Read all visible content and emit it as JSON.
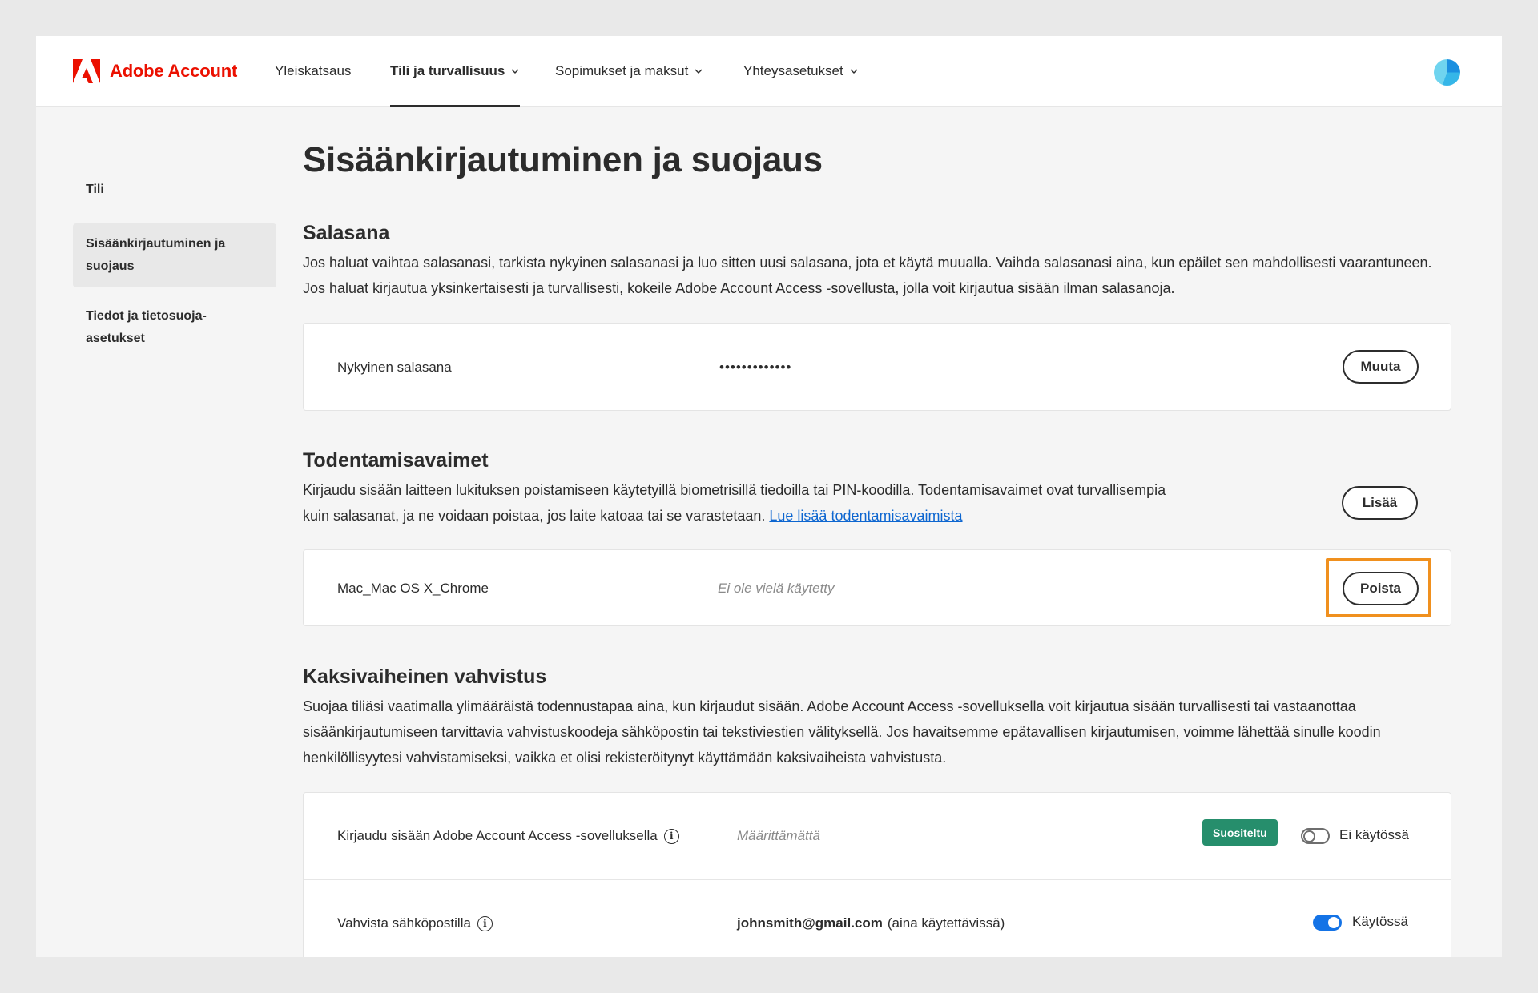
{
  "app": {
    "brand": "Adobe Account",
    "brand_color": "#eb1000"
  },
  "nav": {
    "items": [
      {
        "label": "Yleiskatsaus"
      },
      {
        "label": "Tili ja turvallisuus",
        "active": true
      },
      {
        "label": "Sopimukset ja maksut"
      },
      {
        "label": "Yhteysasetukset"
      }
    ]
  },
  "sidebar": {
    "items": [
      {
        "label": "Tili"
      },
      {
        "label": "Sisäänkirjautuminen ja suojaus",
        "selected": true
      },
      {
        "label": "Tiedot ja tietosuoja-asetukset"
      }
    ]
  },
  "main": {
    "title": "Sisäänkirjautuminen ja suojaus",
    "password": {
      "title": "Salasana",
      "description": "Jos haluat vaihtaa salasanasi, tarkista nykyinen salasanasi ja luo sitten uusi salasana, jota et käytä muualla. Vaihda salasanasi aina, kun epäilet sen mahdollisesti vaarantuneen. Jos haluat kirjautua yksinkertaisesti ja turvallisesti, kokeile Adobe Account Access -sovellusta, jolla voit kirjautua sisään ilman salasanoja.",
      "label": "Nykyinen salasana",
      "value": "•••••••••••••",
      "button": "Muuta"
    },
    "passkeys": {
      "title": "Todentamisavaimet",
      "description": "Kirjaudu sisään laitteen lukituksen poistamiseen käytetyillä biometrisillä tiedoilla tai PIN-koodilla. Todentamisavaimet ovat turvallisempia kuin salasanat, ja ne voidaan poistaa, jos laite katoaa tai se varastetaan.",
      "link": "Lue lisää todentamisavaimista",
      "add_button": "Lisää",
      "device": "Mac_Mac OS X_Chrome",
      "status": "Ei ole vielä käytetty",
      "remove_button": "Poista",
      "highlight_color": "#f0901e"
    },
    "two_step": {
      "title": "Kaksivaiheinen vahvistus",
      "description": "Suojaa tiliäsi vaatimalla ylimääräistä todennustapaa aina, kun kirjaudut sisään. Adobe Account Access -sovelluksella voit kirjautua sisään turvallisesti tai vastaanottaa sisäänkirjautumiseen tarvittavia vahvistuskoodeja sähköpostin tai tekstiviestien välityksellä. Jos havaitsemme epätavallisen kirjautumisen, voimme lähettää sinulle koodin henkilöllisyytesi vahvistamiseksi, vaikka et olisi rekisteröitynyt käyttämään kaksivaiheista vahvistusta.",
      "app_row": {
        "label": "Kirjaudu sisään Adobe Account Access -sovelluksella",
        "value": "Määrittämättä",
        "badge": "Suositeltu",
        "toggle_state": "off",
        "toggle_label": "Ei käytössä"
      },
      "email_row": {
        "label": "Vahvista sähköpostilla",
        "email": "johnsmith@gmail.com",
        "email_note": "(aina käytettävissä)",
        "toggle_state": "on",
        "toggle_label": "Käytössä"
      }
    }
  }
}
